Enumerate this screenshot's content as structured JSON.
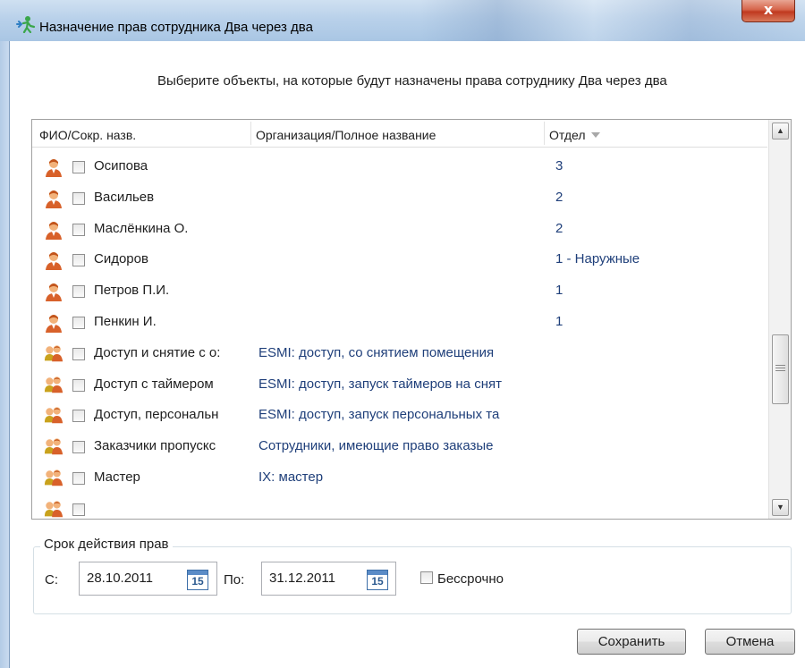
{
  "window": {
    "title": "Назначение прав сотрудника Два через два",
    "close_label": "x"
  },
  "prompt": "Выберите объекты, на которые будут назначены права сотруднику Два через два",
  "table": {
    "columns": [
      "ФИО/Сокр. назв.",
      "Организация/Полное название",
      "Отдел"
    ],
    "sort_column": "Отдел",
    "rows": [
      {
        "type": "person",
        "name": "Осипова",
        "org": "",
        "dept": "3"
      },
      {
        "type": "person",
        "name": "Васильев",
        "org": "",
        "dept": "2"
      },
      {
        "type": "person",
        "name": "Маслёнкина О.",
        "org": "",
        "dept": "2"
      },
      {
        "type": "person",
        "name": "Сидоров",
        "org": "",
        "dept": "1 - Наружные"
      },
      {
        "type": "person",
        "name": "Петров П.И.",
        "org": "",
        "dept": "1"
      },
      {
        "type": "person",
        "name": "Пенкин И.",
        "org": "",
        "dept": "1"
      },
      {
        "type": "group",
        "name": "Доступ и снятие с о:",
        "org": "ESMI: доступ, со снятием помещения",
        "dept": ""
      },
      {
        "type": "group",
        "name": "Доступ с таймером",
        "org": "ESMI: доступ, запуск таймеров на снят",
        "dept": ""
      },
      {
        "type": "group",
        "name": "Доступ, персональн",
        "org": "ESMI: доступ, запуск персональных та",
        "dept": ""
      },
      {
        "type": "group",
        "name": "Заказчики пропускс",
        "org": "Сотрудники, имеющие право заказые",
        "dept": ""
      },
      {
        "type": "group",
        "name": "Мастер",
        "org": "IX: мастер",
        "dept": ""
      },
      {
        "type": "group",
        "name": "",
        "org": "",
        "dept": ""
      }
    ]
  },
  "validity": {
    "legend": "Срок действия прав",
    "from_label": "С:",
    "from_value": "28.10.2011",
    "to_label": "По:",
    "to_value": "31.12.2011",
    "calendar_day": "15",
    "unlimited_label": "Бессрочно"
  },
  "buttons": {
    "save": "Сохранить",
    "cancel": "Отмена"
  },
  "colors": {
    "link_text": "#1f3f7a",
    "titlebar": "#b9d1ea"
  },
  "icons": {
    "title": "person-arrow-icon",
    "person": "person-icon",
    "group": "group-icon",
    "calendar": "calendar-icon"
  }
}
